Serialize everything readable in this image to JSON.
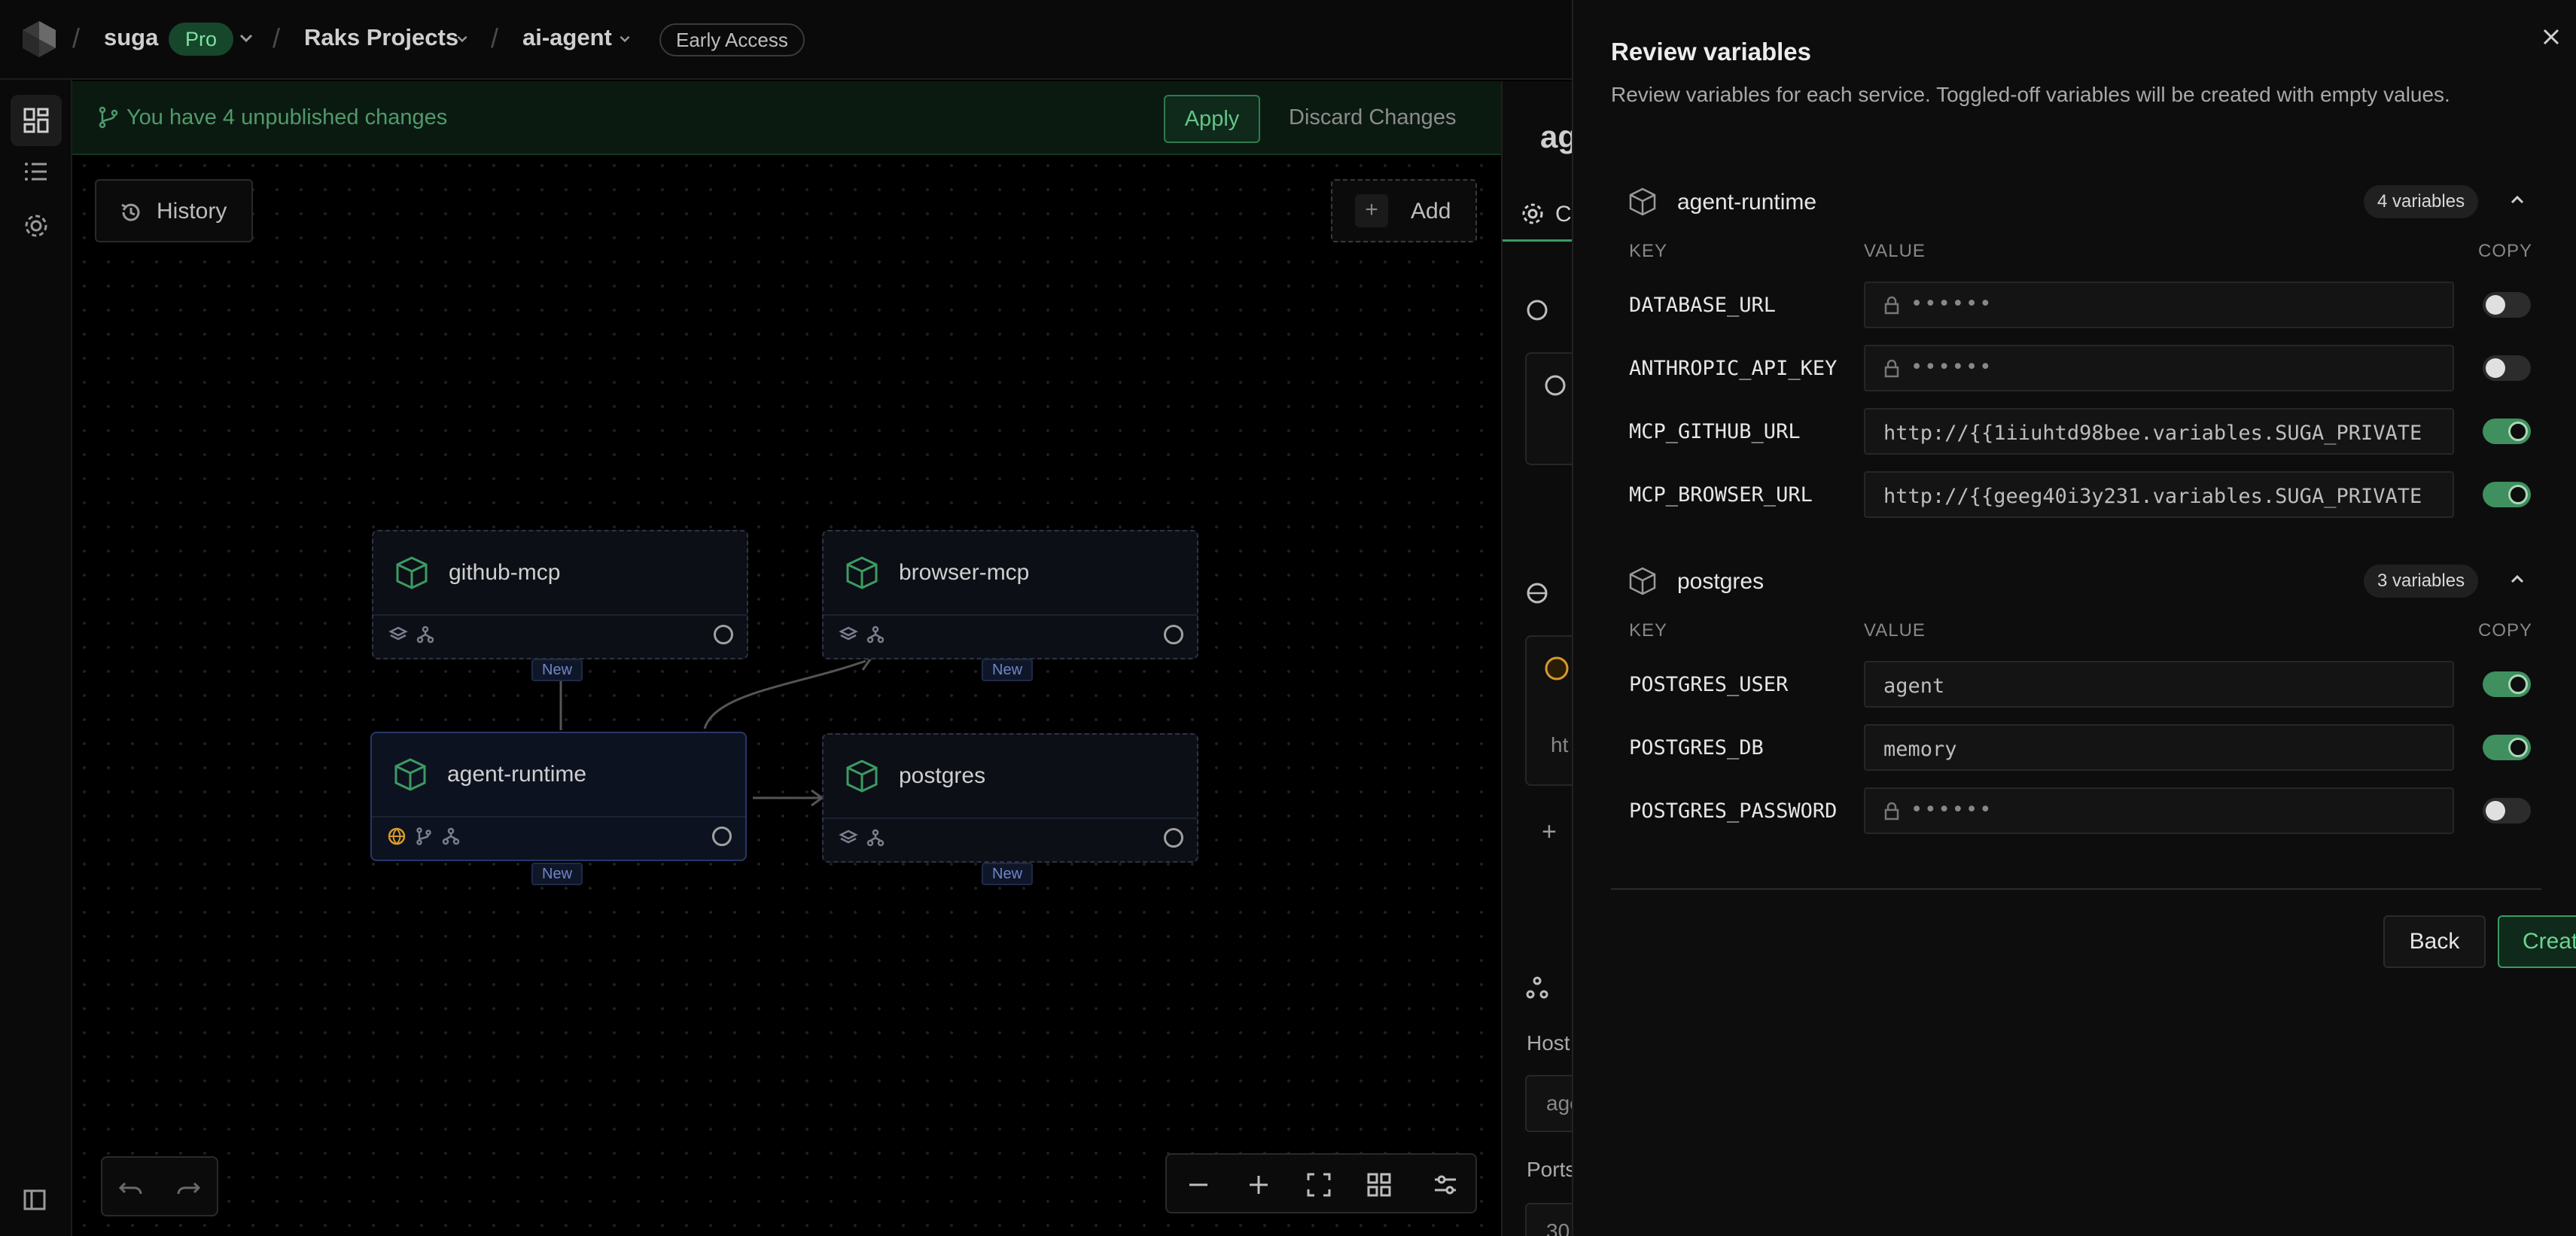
{
  "topbar": {
    "org": "suga",
    "plan_badge": "Pro",
    "project": "Raks Projects",
    "app": "ai-agent",
    "early_access": "Early Access"
  },
  "changes_bar": {
    "message": "You have 4 unpublished changes",
    "apply_label": "Apply",
    "discard_label": "Discard Changes"
  },
  "canvas": {
    "history_label": "History",
    "add_label": "Add",
    "add_icon_glyph": "+",
    "nodes": [
      {
        "name": "github-mcp",
        "tag": "New"
      },
      {
        "name": "browser-mcp",
        "tag": "New"
      },
      {
        "name": "agent-runtime",
        "tag": "New"
      },
      {
        "name": "postgres",
        "tag": "New"
      }
    ]
  },
  "middle_panel": {
    "title": "ag",
    "tab_label": "Co",
    "host_label": "Host",
    "host_value": "age",
    "ports_label": "Ports",
    "partial_input": "ht",
    "plus": "+",
    "ports_value": "30"
  },
  "drawer": {
    "title": "Review variables",
    "subtitle": "Review variables for each service. Toggled-off variables will be created with empty values.",
    "col_key": "KEY",
    "col_value": "VALUE",
    "col_copy": "COPY",
    "masked": "••••••",
    "services": [
      {
        "name": "agent-runtime",
        "count": "4 variables",
        "vars": [
          {
            "key": "DATABASE_URL",
            "value": "",
            "masked": true,
            "copy": false
          },
          {
            "key": "ANTHROPIC_API_KEY",
            "value": "",
            "masked": true,
            "copy": false
          },
          {
            "key": "MCP_GITHUB_URL",
            "value": "http://{{1iiuhtd98bee.variables.SUGA_PRIVATE",
            "masked": false,
            "copy": true
          },
          {
            "key": "MCP_BROWSER_URL",
            "value": "http://{{geeg40i3y231.variables.SUGA_PRIVATE",
            "masked": false,
            "copy": true
          }
        ]
      },
      {
        "name": "postgres",
        "count": "3 variables",
        "vars": [
          {
            "key": "POSTGRES_USER",
            "value": "agent",
            "masked": false,
            "copy": true
          },
          {
            "key": "POSTGRES_DB",
            "value": "memory",
            "masked": false,
            "copy": true
          },
          {
            "key": "POSTGRES_PASSWORD",
            "value": "",
            "masked": true,
            "copy": false
          }
        ]
      }
    ],
    "back_label": "Back",
    "create_label": "Create"
  },
  "colors": {
    "accent_green": "#3c9b62",
    "toggle_on": "#3f8f5f",
    "node_border": "#2f3442",
    "selected_border": "#26386a"
  }
}
